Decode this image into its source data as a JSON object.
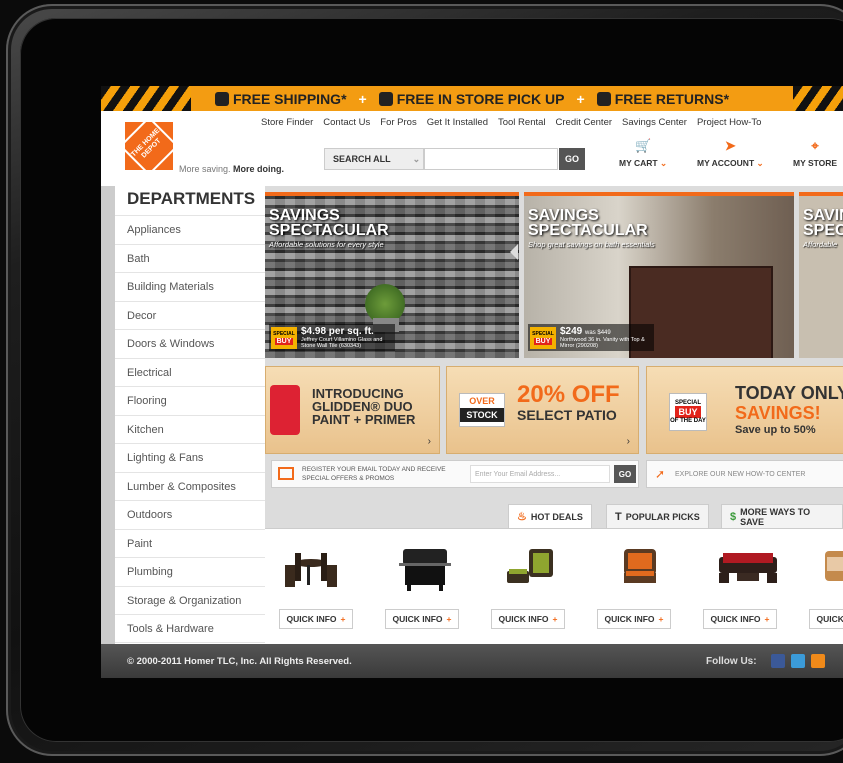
{
  "promo": {
    "items": [
      "FREE SHIPPING*",
      "+",
      "FREE IN STORE PICK UP",
      "+",
      "FREE RETURNS*"
    ]
  },
  "topnav": [
    "Store Finder",
    "Contact Us",
    "For Pros",
    "Get It Installed",
    "Tool Rental",
    "Credit Center",
    "Savings Center",
    "Project How-To"
  ],
  "brand": {
    "logo_text": "THE HOME DEPOT",
    "tagline_start": "More saving.",
    "tagline_bold": "More doing."
  },
  "search": {
    "scope": "SEARCH ALL",
    "placeholder": "",
    "go": "GO"
  },
  "account": {
    "cart": "MY CART",
    "account": "MY ACCOUNT",
    "store": "MY STORE"
  },
  "departments": {
    "title": "DEPARTMENTS",
    "items": [
      "Appliances",
      "Bath",
      "Building Materials",
      "Decor",
      "Doors & Windows",
      "Electrical",
      "Flooring",
      "Kitchen",
      "Lighting & Fans",
      "Lumber & Composites",
      "Outdoors",
      "Paint",
      "Plumbing",
      "Storage & Organization",
      "Tools & Hardware"
    ]
  },
  "banners": [
    {
      "title": "SAVINGS SPECTACULAR",
      "subtitle": "Affordable solutions for every style",
      "badge_top": "SPECIAL",
      "badge_bottom": "BUY",
      "price": "$4.98 per sq. ft.",
      "desc": "Jeffrey Court Villamino Glass and Stone Wall Tile (630343)"
    },
    {
      "title": "SAVINGS SPECTACULAR",
      "subtitle": "Shop great savings on bath essentials",
      "badge_top": "SPECIAL",
      "badge_bottom": "BUY",
      "price": "$249",
      "price_was": "was $449",
      "desc": "Northwood 36 in. Vanity with Top & Mirror (290208)"
    },
    {
      "title": "SAVINGS SPECTACULAR",
      "subtitle": "Affordable"
    }
  ],
  "tiles": {
    "t1": "INTRODUCING GLIDDEN® DUO PAINT + PRIMER",
    "t2_badge_top": "OVER",
    "t2_badge_bottom": "STOCK",
    "t2_big": "20% OFF",
    "t2_sub": "SELECT PATIO",
    "t3_badge_top": "SPECIAL",
    "t3_badge_mid": "BUY",
    "t3_badge_bottom": "OF THE DAY",
    "t3_l1": "TODAY ONLY",
    "t3_l2": "SAVINGS!",
    "t3_l3": "Save up to 50%"
  },
  "email": {
    "label": "REGISTER YOUR EMAIL TODAY AND RECEIVE SPECIAL OFFERS & PROMOS",
    "placeholder": "Enter Your Email Address...",
    "go": "GO"
  },
  "howto": "EXPLORE OUR NEW HOW-TO CENTER",
  "tabs": [
    "HOT DEALS",
    "POPULAR PICKS",
    "MORE WAYS TO SAVE"
  ],
  "products": {
    "quick_info": "QUICK INFO",
    "count": 6
  },
  "footer": {
    "copyright": "© 2000-2011 Homer TLC, Inc. All Rights Reserved.",
    "follow": "Follow Us:"
  },
  "colors": {
    "brand_orange": "#f26a1a",
    "promo_yellow": "#f39c12",
    "special_buy_yellow": "#f3b100",
    "special_buy_red": "#e2231a"
  }
}
